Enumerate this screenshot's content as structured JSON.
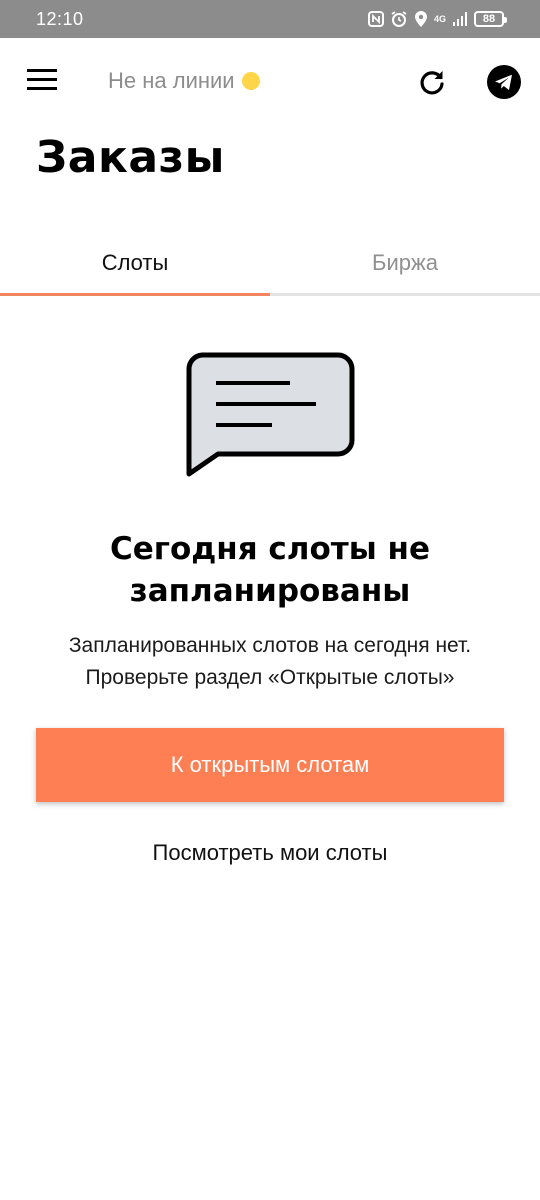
{
  "status_bar": {
    "time": "12:10",
    "battery_level": "88",
    "network_label": "4G"
  },
  "header": {
    "status_label": "Не на линии",
    "status_dot_color": "#ffd54a"
  },
  "page": {
    "title": "Заказы"
  },
  "tabs": [
    {
      "label": "Слоты",
      "active": true
    },
    {
      "label": "Биржа",
      "active": false
    }
  ],
  "empty_state": {
    "title_line1": "Сегодня слоты не",
    "title_line2": "запланированы",
    "description_line1": "Запланированных слотов на сегодня нет.",
    "description_line2": "Проверьте раздел «Открытые слоты»"
  },
  "actions": {
    "primary_label": "К открытым слотам",
    "secondary_label": "Посмотреть мои слоты"
  },
  "colors": {
    "accent": "#ff7f55",
    "tab_indicator": "#f28560",
    "status_bar": "#8c8c8c"
  }
}
